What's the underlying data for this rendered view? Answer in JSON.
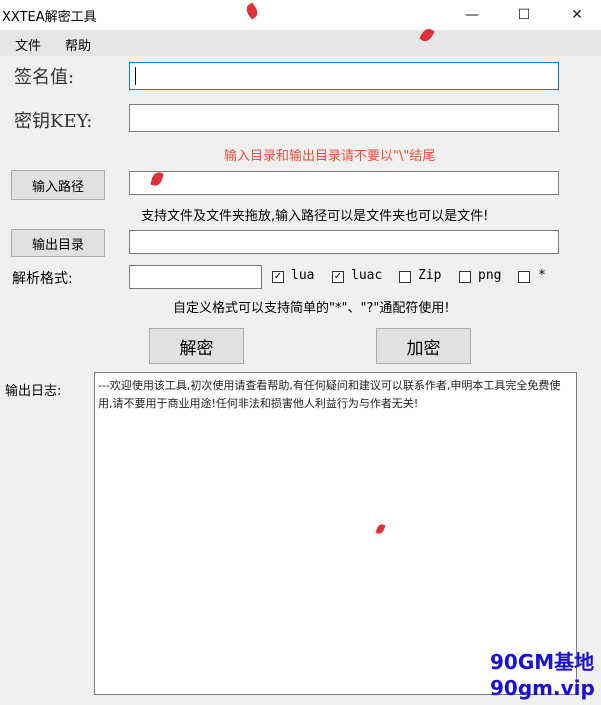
{
  "window": {
    "title": "XXTEA解密工具",
    "minimize_glyph": "—",
    "maximize_glyph": "☐",
    "close_glyph": "✕"
  },
  "menu": {
    "items": [
      "文件",
      "帮助"
    ]
  },
  "form": {
    "signature_label": "签名值:",
    "signature_value": "",
    "key_label": "密钥KEY:",
    "key_value": "",
    "path_warning": "输入目录和输出目录请不要以\"\\\"结尾",
    "input_path_button": "输入路径",
    "input_path_value": "",
    "input_path_hint": "支持文件及文件夹拖放,输入路径可以是文件夹也可以是文件!",
    "output_dir_button": "输出目录",
    "output_dir_value": "",
    "format_label": "解析格式:",
    "format_value": "",
    "format_options": [
      {
        "label": "lua",
        "checked": true
      },
      {
        "label": "luac",
        "checked": true
      },
      {
        "label": "Zip",
        "checked": false
      },
      {
        "label": "png",
        "checked": false
      },
      {
        "label": "*",
        "checked": false
      }
    ],
    "wildcard_hint": "自定义格式可以支持简单的\"*\"、\"?\"通配符使用!",
    "decrypt_button": "解密",
    "encrypt_button": "加密"
  },
  "log": {
    "label": "输出日志:",
    "content": "---欢迎使用该工具,初次使用请查看帮助,有任何疑问和建议可以联系作者,申明本工具完全免费使用,请不要用于商业用途!任何非法和损害他人利益行为与作者无关!"
  },
  "watermark": {
    "line1": "90GM基地",
    "line2": "90gm.vip"
  },
  "colors": {
    "warning": "#e8503a",
    "watermark": "#1a0fd8",
    "focus_border": "#0078d7"
  }
}
